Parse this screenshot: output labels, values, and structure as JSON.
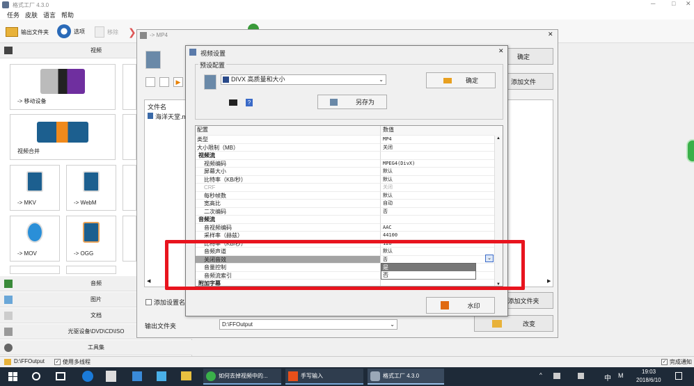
{
  "app": {
    "title": "格式工厂 4.3.0"
  },
  "menu": [
    "任务",
    "皮肤",
    "语言",
    "帮助"
  ],
  "toolbar": {
    "output_folder": "输出文件夹",
    "options": "选项",
    "remove": "移除"
  },
  "sidebar": {
    "video_header": "视频",
    "tiles": [
      "-> 移动设备",
      "视频合并",
      "-> MKV",
      "-> WebM",
      "-> MOV",
      "-> OGG"
    ],
    "categories": [
      "音频",
      "图片",
      "文档",
      "光驱设备\\DVD\\CD\\ISO",
      "工具集"
    ]
  },
  "mp4": {
    "title": "-> MP4",
    "ok": "确定",
    "add_file": "添加文件",
    "file_col": "文件名",
    "file_row": "海洋天堂.m",
    "add_folder": "添加文件夹",
    "add_setting_name": "添加设置名称",
    "output_label": "输出文件夹",
    "output_value": "D:\\FFOutput",
    "change": "改变"
  },
  "dlg": {
    "title": "视频设置",
    "preset_group": "预设配置",
    "preset_value": "DIVX 高质量和大小",
    "ok": "确定",
    "save_as": "另存为",
    "col_config": "配置",
    "col_value": "数值",
    "watermark": "水印",
    "rows": [
      {
        "k": "类型",
        "v": "MP4"
      },
      {
        "k": "大小限制（MB）",
        "v": "关闭"
      },
      {
        "k": "视频流",
        "v": ""
      },
      {
        "k": "视频编码",
        "v": "MPEG4(DivX)"
      },
      {
        "k": "屏幕大小",
        "v": "默认"
      },
      {
        "k": "比特率（KB/秒）",
        "v": "默认"
      },
      {
        "k": "CRF",
        "v": "关闭"
      },
      {
        "k": "每秒帧数",
        "v": "默认"
      },
      {
        "k": "宽高比",
        "v": "自动"
      },
      {
        "k": "二次编码",
        "v": "否"
      },
      {
        "k": "音频流",
        "v": ""
      },
      {
        "k": "音视频编码",
        "v": "AAC"
      },
      {
        "k": "采样率（赫兹）",
        "v": "44100"
      },
      {
        "k": "比特率（KB/秒）",
        "v": "128"
      },
      {
        "k": "音频声道",
        "v": "默认"
      },
      {
        "k": "关闭音效",
        "v": "否"
      },
      {
        "k": "音量控制",
        "v": ""
      },
      {
        "k": "音频流索引",
        "v": ""
      },
      {
        "k": "附加字幕",
        "v": ""
      }
    ],
    "dropdown_options": [
      "是",
      "否"
    ]
  },
  "status": {
    "path": "D:\\FFOutput",
    "multithread": "使用多线程",
    "done_notify": "完成通知"
  },
  "taskbar": {
    "app1": "如何去掉视频中的...",
    "app2": "手写输入",
    "app3": "格式工厂 4.3.0",
    "time": "19:03",
    "date": "2018/6/10",
    "ime": "中"
  },
  "colors": {
    "highlight": "#e8141e",
    "taskbar": "#1e2a38"
  }
}
